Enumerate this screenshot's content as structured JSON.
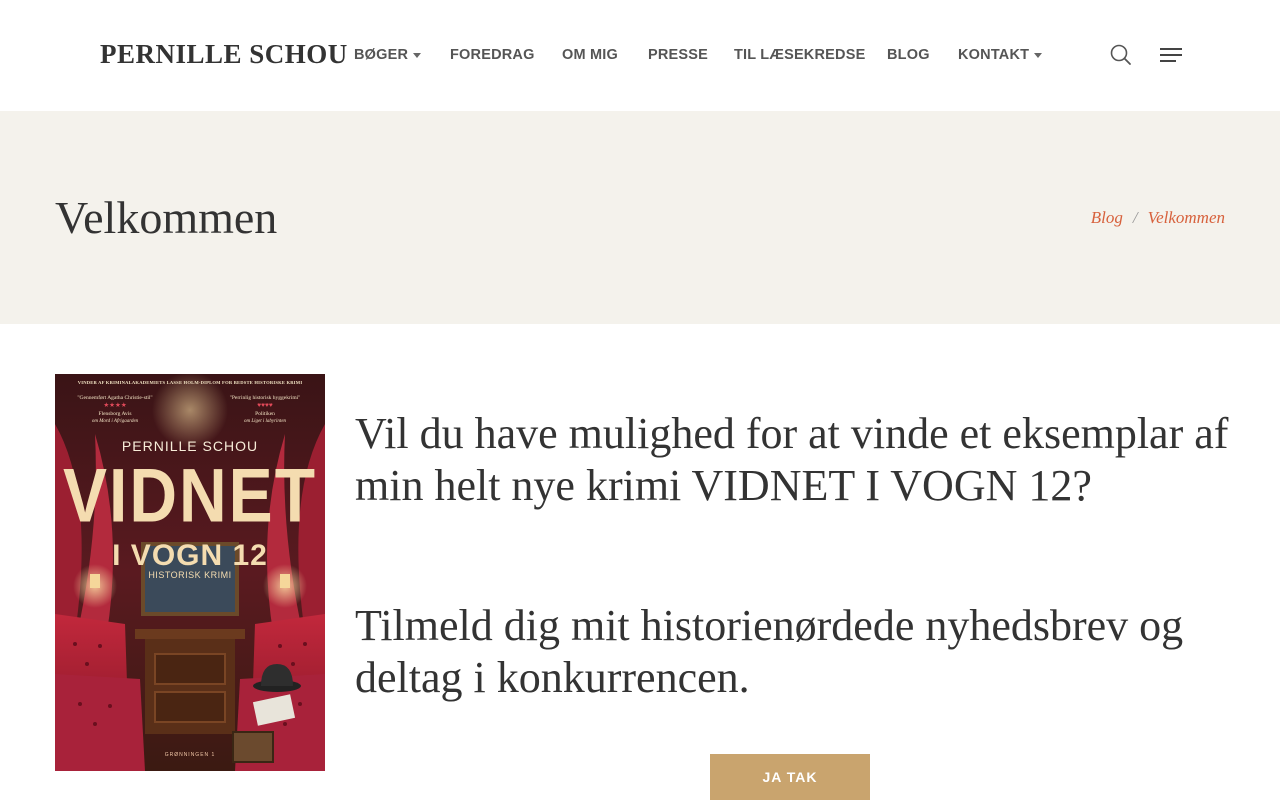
{
  "header": {
    "logo": "PERNILLE SCHOU",
    "nav": [
      {
        "label": "BØGER",
        "has_dropdown": true
      },
      {
        "label": "FOREDRAG",
        "has_dropdown": false
      },
      {
        "label": "OM MIG",
        "has_dropdown": false
      },
      {
        "label": "PRESSE",
        "has_dropdown": false
      },
      {
        "label": "TIL LÆSEKREDSE",
        "has_dropdown": false
      },
      {
        "label": "BLOG",
        "has_dropdown": false
      },
      {
        "label": "KONTAKT",
        "has_dropdown": true
      }
    ],
    "icons": {
      "search": "search-icon",
      "menu": "hamburger-menu-icon"
    }
  },
  "banner": {
    "title": "Velkommen",
    "breadcrumb": [
      {
        "label": "Blog"
      },
      {
        "label": "Velkommen"
      }
    ],
    "breadcrumb_separator": "/"
  },
  "main": {
    "book_cover": {
      "top_line": "VINDER AF KRIMINALAKADEMIETS LASSE HOLM-DIPLOM FOR BEDSTE HISTORISKE KRIMI",
      "quote_left": "\"Gennemført Agatha Christie-stil\"",
      "rating_left": "★★★★",
      "source_left": "Flensborg Avis",
      "source_left_sub": "om Mord i Afrigaarden",
      "quote_right": "\"Perrinlig historisk hyggekrimi\"",
      "rating_right": "♥♥♥♥",
      "source_right": "Politiken",
      "source_right_sub": "om Liget i labyrinten",
      "author": "PERNILLE SCHOU",
      "title_line1": "VIDNET",
      "title_line2": "I VOGN 12",
      "genre": "HISTORISK KRIMI",
      "publisher": "GRØNNINGEN 1"
    },
    "headline": "Vil du have mulighed for at vinde et eksemplar af min helt nye krimi VIDNET I VOGN 12?",
    "subline": "Tilmeld dig mit historienørdede nyhedsbrev og deltag i konkurrencen.",
    "cta_label": "JA TAK"
  },
  "colors": {
    "accent": "#d7613c",
    "button": "#c9a46e",
    "banner_bg": "#f4f2ec",
    "cover_red": "#8e1b2a"
  }
}
